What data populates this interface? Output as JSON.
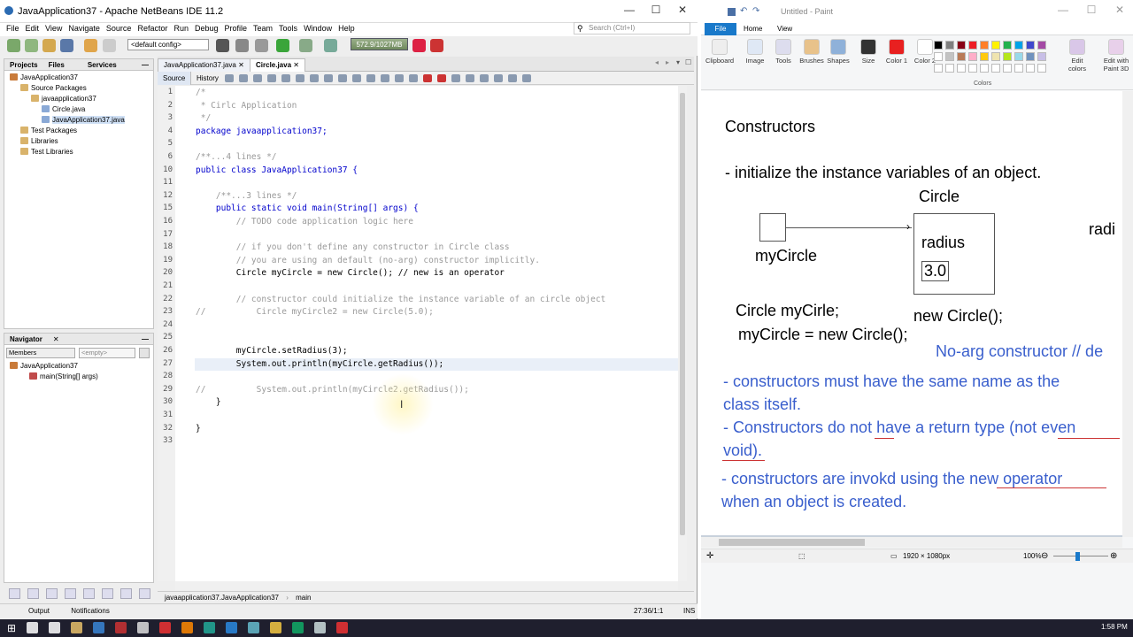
{
  "netbeans": {
    "title": "JavaApplication37 - Apache NetBeans IDE 11.2",
    "menu": [
      "File",
      "Edit",
      "View",
      "Navigate",
      "Source",
      "Refactor",
      "Run",
      "Debug",
      "Profile",
      "Team",
      "Tools",
      "Window",
      "Help"
    ],
    "search_placeholder": "Search (Ctrl+I)",
    "config": "<default config>",
    "memory": "572.9/1027MB",
    "panel_tabs": [
      "Projects",
      "Files",
      "Services"
    ],
    "tree": [
      {
        "label": "JavaApplication37",
        "indent": 0,
        "icon": "#c97b3a"
      },
      {
        "label": "Source Packages",
        "indent": 1,
        "icon": "#d9b36b"
      },
      {
        "label": "javaapplication37",
        "indent": 2,
        "icon": "#d9b36b"
      },
      {
        "label": "Circle.java",
        "indent": 3,
        "icon": "#8aa9d6"
      },
      {
        "label": "JavaApplication37.java",
        "indent": 3,
        "icon": "#8aa9d6"
      },
      {
        "label": "Test Packages",
        "indent": 1,
        "icon": "#d9b36b"
      },
      {
        "label": "Libraries",
        "indent": 1,
        "icon": "#d9b36b"
      },
      {
        "label": "Test Libraries",
        "indent": 1,
        "icon": "#d9b36b"
      }
    ],
    "navigator_title": "Navigator",
    "navigator_filter": "Members",
    "navigator_empty": "<empty>",
    "nav_tree": [
      {
        "label": "JavaApplication37",
        "indent": 0
      },
      {
        "label": "main(String[] args)",
        "indent": 1
      }
    ],
    "editor_tabs": [
      "JavaApplication37.java",
      "Circle.java"
    ],
    "editor_modes": [
      "Source",
      "History"
    ],
    "breadcrumb": [
      "javaapplication37.JavaApplication37",
      "main"
    ],
    "status_left": [
      "Output",
      "Notifications"
    ],
    "cursor_pos": "27:36/1:1",
    "ins": "INS"
  },
  "code_lines": [
    {
      "n": "1",
      "t": "/*",
      "c": "cm"
    },
    {
      "n": "2",
      "t": " * Cirlc Application",
      "c": "cm"
    },
    {
      "n": "3",
      "t": " */",
      "c": "cm"
    },
    {
      "n": "4",
      "t": "package javaapplication37;",
      "c": "kw"
    },
    {
      "n": "5",
      "t": "",
      "c": ""
    },
    {
      "n": "6",
      "t": "/**...4 lines */",
      "c": "gy"
    },
    {
      "n": "10",
      "t": "public class JavaApplication37 {",
      "c": "kw"
    },
    {
      "n": "11",
      "t": "",
      "c": ""
    },
    {
      "n": "12",
      "t": "    /**...3 lines */",
      "c": "gy"
    },
    {
      "n": "15",
      "t": "    public static void main(String[] args) {",
      "c": "kw"
    },
    {
      "n": "16",
      "t": "        // TODO code application logic here",
      "c": "cm"
    },
    {
      "n": "17",
      "t": "",
      "c": ""
    },
    {
      "n": "18",
      "t": "        // if you don't define any constructor in Circle class",
      "c": "cm"
    },
    {
      "n": "19",
      "t": "        // you are using an default (no-arg) constructor implicitly.",
      "c": "cm"
    },
    {
      "n": "20",
      "t": "        Circle myCircle = new Circle(); // new is an operator",
      "c": ""
    },
    {
      "n": "21",
      "t": "",
      "c": ""
    },
    {
      "n": "22",
      "t": "        // constructor could initialize the instance variable of an circle object",
      "c": "cm"
    },
    {
      "n": "23",
      "t": "//          Circle myCircle2 = new Circle(5.0);",
      "c": "cm"
    },
    {
      "n": "24",
      "t": "",
      "c": ""
    },
    {
      "n": "25",
      "t": "",
      "c": ""
    },
    {
      "n": "26",
      "t": "        myCircle.setRadius(3);",
      "c": ""
    },
    {
      "n": "27",
      "t": "        System.out.println(myCircle.getRadius());",
      "c": ""
    },
    {
      "n": "28",
      "t": "",
      "c": ""
    },
    {
      "n": "29",
      "t": "//          System.out.println(myCircle2.getRadius());",
      "c": "cm"
    },
    {
      "n": "30",
      "t": "    }",
      "c": ""
    },
    {
      "n": "31",
      "t": "",
      "c": ""
    },
    {
      "n": "32",
      "t": "}",
      "c": ""
    },
    {
      "n": "33",
      "t": "",
      "c": ""
    }
  ],
  "paint": {
    "title": "Untitled - Paint",
    "tabs": [
      "File",
      "Home",
      "View"
    ],
    "groups": [
      "Clipboard",
      "Image",
      "Tools",
      "Brushes",
      "Shapes",
      "Size",
      "Color 1",
      "Color 2",
      "Edit colors",
      "Edit with Paint 3D"
    ],
    "colors_label": "Colors",
    "canvas_size": "1920 × 1080px",
    "zoom": "100%",
    "canvas_text": {
      "heading": "Constructors",
      "line1": "- initialize the instance variables of an object.",
      "circle_label": "Circle",
      "radius": "radius",
      "radius_val": "3.0",
      "mycircle": "myCircle",
      "radi": "radi",
      "decl1": "Circle myCirle;",
      "decl2": "myCircle = new Circle();",
      "newc": "new Circle();",
      "noarg": "No-arg constructor // de",
      "b1a": "- constructors must have the same name as the",
      "b1b": "class itself.",
      "b2a": "- Constructors do not have a return type (not even",
      "b2b": "void).",
      "b3a": "- constructors are invokd using the new operator",
      "b3b": "when an object is created."
    }
  },
  "taskbar": {
    "time": "1:58 PM"
  }
}
